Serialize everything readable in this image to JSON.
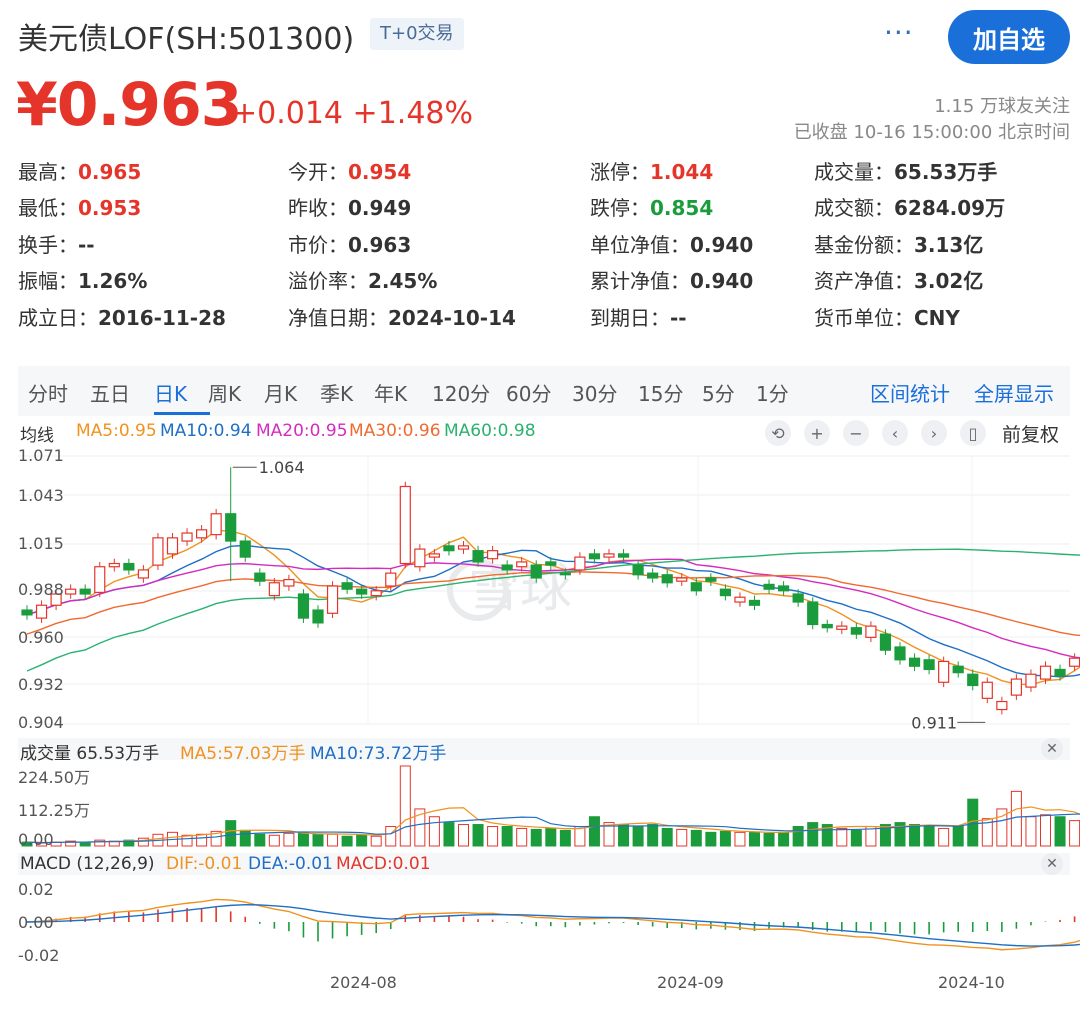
{
  "header": {
    "title": "美元债LOF(SH:501300)",
    "tag": "T+0交易",
    "more": "···",
    "add_button": "加自选"
  },
  "quote": {
    "price": "¥0.963",
    "change": "+0.014 +1.48%",
    "followers": "1.15 万球友关注",
    "status": "已收盘 10-16 15:00:00 北京时间"
  },
  "stats": {
    "r1": [
      {
        "k": "最高：",
        "v": "0.965"
      },
      {
        "k": "今开：",
        "v": "0.954"
      },
      {
        "k": "涨停：",
        "v": "1.044"
      },
      {
        "k": "成交量：",
        "v": "65.53万手"
      }
    ],
    "r2": [
      {
        "k": "最低：",
        "v": "0.953"
      },
      {
        "k": "昨收：",
        "v": "0.949"
      },
      {
        "k": "跌停：",
        "v": "0.854"
      },
      {
        "k": "成交额：",
        "v": "6284.09万"
      }
    ],
    "r3": [
      {
        "k": "换手：",
        "v": "--"
      },
      {
        "k": "市价：",
        "v": "0.963"
      },
      {
        "k": "单位净值：",
        "v": "0.940"
      },
      {
        "k": "基金份额：",
        "v": "3.13亿"
      }
    ],
    "r4": [
      {
        "k": "振幅：",
        "v": "1.26%"
      },
      {
        "k": "溢价率：",
        "v": "2.45%"
      },
      {
        "k": "累计净值：",
        "v": "0.940"
      },
      {
        "k": "资产净值：",
        "v": "3.02亿"
      }
    ],
    "r5": [
      {
        "k": "成立日：",
        "v": "2016-11-28"
      },
      {
        "k": "净值日期：",
        "v": "2024-10-14"
      },
      {
        "k": "到期日：",
        "v": "--"
      },
      {
        "k": "货币单位：",
        "v": "CNY"
      }
    ]
  },
  "tabs": {
    "items": [
      "分时",
      "五日",
      "日K",
      "周K",
      "月K",
      "季K",
      "年K",
      "120分",
      "60分",
      "30分",
      "15分",
      "5分",
      "1分"
    ],
    "active": "日K",
    "range_stats": "区间统计",
    "fullscreen": "全屏显示"
  },
  "kline": {
    "ma_label": "均线",
    "ma": [
      {
        "label": "MA5:0.95",
        "color": "#f0921f"
      },
      {
        "label": "MA10:0.94",
        "color": "#1e6fc6"
      },
      {
        "label": "MA20:0.95",
        "color": "#d42cc0"
      },
      {
        "label": "MA30:0.96",
        "color": "#f06a30"
      },
      {
        "label": "MA60:0.98",
        "color": "#29b36f"
      }
    ],
    "adjust": "前复权",
    "y_ticks": [
      "1.071",
      "1.043",
      "1.015",
      "0.988",
      "0.960",
      "0.932",
      "0.904"
    ],
    "high_label": "1.064",
    "low_label": "0.911",
    "watermark": "雪球"
  },
  "volume": {
    "label": "成交量 65.53万手",
    "ma5": "MA5:57.03万手",
    "ma10": "MA10:73.72万手",
    "y_ticks": [
      "224.50万",
      "112.25万",
      "0.00"
    ]
  },
  "macd": {
    "label": "MACD (12,26,9)",
    "dif": "DIF:-0.01",
    "dea": "DEA:-0.01",
    "macd": "MACD:0.01",
    "y_ticks": [
      "0.02",
      "0.00",
      "-0.02"
    ]
  },
  "x_axis": [
    "2024-08",
    "2024-09",
    "2024-10"
  ],
  "colors": {
    "up": "#e5352b",
    "down": "#1a9c3c",
    "accent": "#1b6fd9"
  },
  "chart_data": {
    "type": "candlestick",
    "ylim": [
      0.904,
      1.071
    ],
    "candles": [
      {
        "o": 0.975,
        "c": 0.972
      },
      {
        "o": 0.97,
        "c": 0.978
      },
      {
        "o": 0.978,
        "c": 0.985
      },
      {
        "o": 0.985,
        "c": 0.988
      },
      {
        "o": 0.988,
        "c": 0.985
      },
      {
        "o": 0.986,
        "c": 1.002
      },
      {
        "o": 1.002,
        "c": 1.004
      },
      {
        "o": 1.004,
        "c": 1.0
      },
      {
        "o": 0.995,
        "c": 1.0
      },
      {
        "o": 1.003,
        "c": 1.02
      },
      {
        "o": 1.01,
        "c": 1.02
      },
      {
        "o": 1.018,
        "c": 1.023
      },
      {
        "o": 1.02,
        "c": 1.025
      },
      {
        "o": 1.022,
        "c": 1.035
      },
      {
        "o": 1.035,
        "c": 1.018,
        "h": 1.064,
        "l": 0.993
      },
      {
        "o": 1.018,
        "c": 1.008
      },
      {
        "o": 0.998,
        "c": 0.993
      },
      {
        "o": 0.984,
        "c": 0.992
      },
      {
        "o": 0.99,
        "c": 0.994
      },
      {
        "o": 0.985,
        "c": 0.97
      },
      {
        "o": 0.975,
        "c": 0.967
      },
      {
        "o": 0.973,
        "c": 0.99
      },
      {
        "o": 0.992,
        "c": 0.988
      },
      {
        "o": 0.988,
        "c": 0.985
      },
      {
        "o": 0.984,
        "c": 0.987
      },
      {
        "o": 0.99,
        "c": 0.998
      },
      {
        "o": 1.004,
        "c": 1.052
      },
      {
        "o": 1.002,
        "c": 1.013
      },
      {
        "o": 1.008,
        "c": 1.01
      },
      {
        "o": 1.015,
        "c": 1.012
      },
      {
        "o": 1.013,
        "c": 1.015
      },
      {
        "o": 1.012,
        "c": 1.005
      },
      {
        "o": 1.007,
        "c": 1.012
      },
      {
        "o": 1.003,
        "c": 1.0
      },
      {
        "o": 1.002,
        "c": 1.005
      },
      {
        "o": 1.003,
        "c": 0.995
      },
      {
        "o": 1.005,
        "c": 1.003
      },
      {
        "o": 0.998,
        "c": 0.997
      },
      {
        "o": 1.0,
        "c": 1.008
      },
      {
        "o": 1.01,
        "c": 1.007
      },
      {
        "o": 1.008,
        "c": 1.01
      },
      {
        "o": 1.01,
        "c": 1.008
      },
      {
        "o": 1.003,
        "c": 0.997
      },
      {
        "o": 0.998,
        "c": 0.995
      },
      {
        "o": 0.997,
        "c": 0.992
      },
      {
        "o": 0.993,
        "c": 0.995
      },
      {
        "o": 0.992,
        "c": 0.987
      },
      {
        "o": 0.995,
        "c": 0.993
      },
      {
        "o": 0.988,
        "c": 0.984
      },
      {
        "o": 0.98,
        "c": 0.983
      },
      {
        "o": 0.981,
        "c": 0.978
      },
      {
        "o": 0.991,
        "c": 0.988
      },
      {
        "o": 0.99,
        "c": 0.987
      },
      {
        "o": 0.985,
        "c": 0.98
      },
      {
        "o": 0.98,
        "c": 0.966
      },
      {
        "o": 0.966,
        "c": 0.964
      },
      {
        "o": 0.963,
        "c": 0.965
      },
      {
        "o": 0.964,
        "c": 0.96
      },
      {
        "o": 0.958,
        "c": 0.965
      },
      {
        "o": 0.96,
        "c": 0.95
      },
      {
        "o": 0.952,
        "c": 0.944
      },
      {
        "o": 0.945,
        "c": 0.94
      },
      {
        "o": 0.944,
        "c": 0.938
      },
      {
        "o": 0.93,
        "c": 0.943
      },
      {
        "o": 0.94,
        "c": 0.936
      },
      {
        "o": 0.935,
        "c": 0.928
      },
      {
        "o": 0.92,
        "c": 0.93
      },
      {
        "o": 0.913,
        "c": 0.918
      },
      {
        "o": 0.922,
        "c": 0.932
      },
      {
        "o": 0.927,
        "c": 0.935
      },
      {
        "o": 0.932,
        "c": 0.94
      },
      {
        "o": 0.938,
        "c": 0.934
      },
      {
        "o": 0.94,
        "c": 0.945
      },
      {
        "o": 0.953,
        "c": 0.963
      }
    ]
  }
}
